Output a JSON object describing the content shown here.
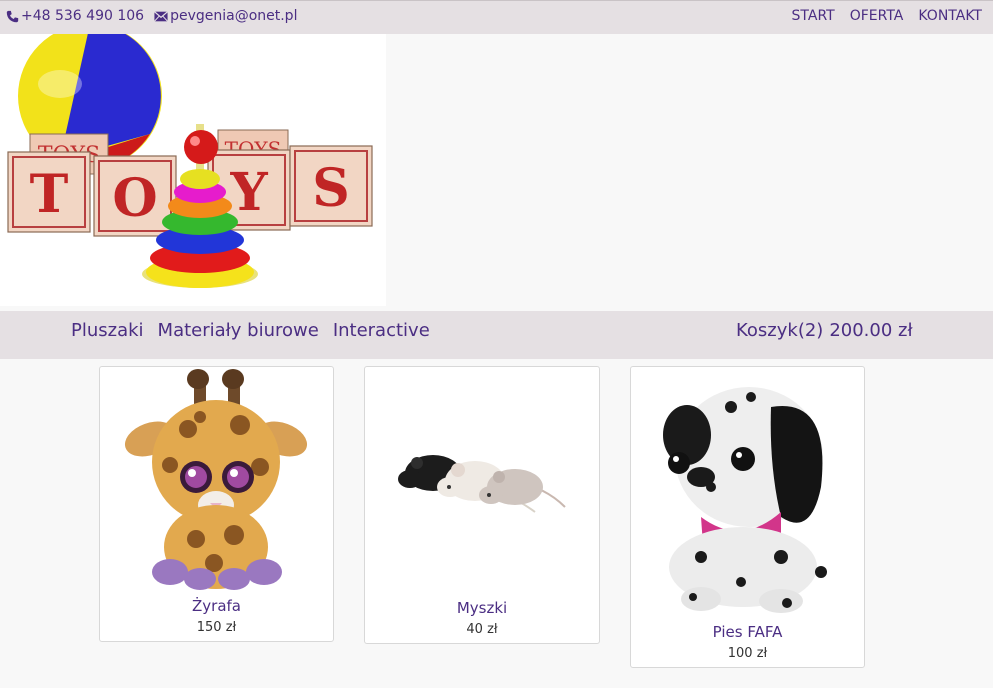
{
  "topbar": {
    "phone": "+48 536 490 106",
    "email": "pevgenia@onet.pl",
    "phone_icon": "phone-icon",
    "email_icon": "envelope-icon",
    "nav": [
      {
        "label": "START"
      },
      {
        "label": "OFERTA"
      },
      {
        "label": "KONTAKT"
      }
    ]
  },
  "banner": {
    "blocks": [
      "T",
      "O",
      "Y",
      "S"
    ],
    "back_blocks": [
      "TOYS",
      "TOYS"
    ]
  },
  "categories": [
    {
      "label": "Pluszaki"
    },
    {
      "label": "Materiały biurowe"
    },
    {
      "label": "Interactive"
    }
  ],
  "cart": {
    "label": "Koszyk(2)",
    "total": "200.00 zł"
  },
  "products": [
    {
      "name": "Żyrafa",
      "price": "150 zł"
    },
    {
      "name": "Myszki",
      "price": "40 zł"
    },
    {
      "name": "Pies FAFA",
      "price": "100 zł"
    }
  ],
  "colors": {
    "accent": "#4b2e83",
    "bar_bg": "#e5e0e3",
    "page_bg": "#f8f8f8"
  }
}
